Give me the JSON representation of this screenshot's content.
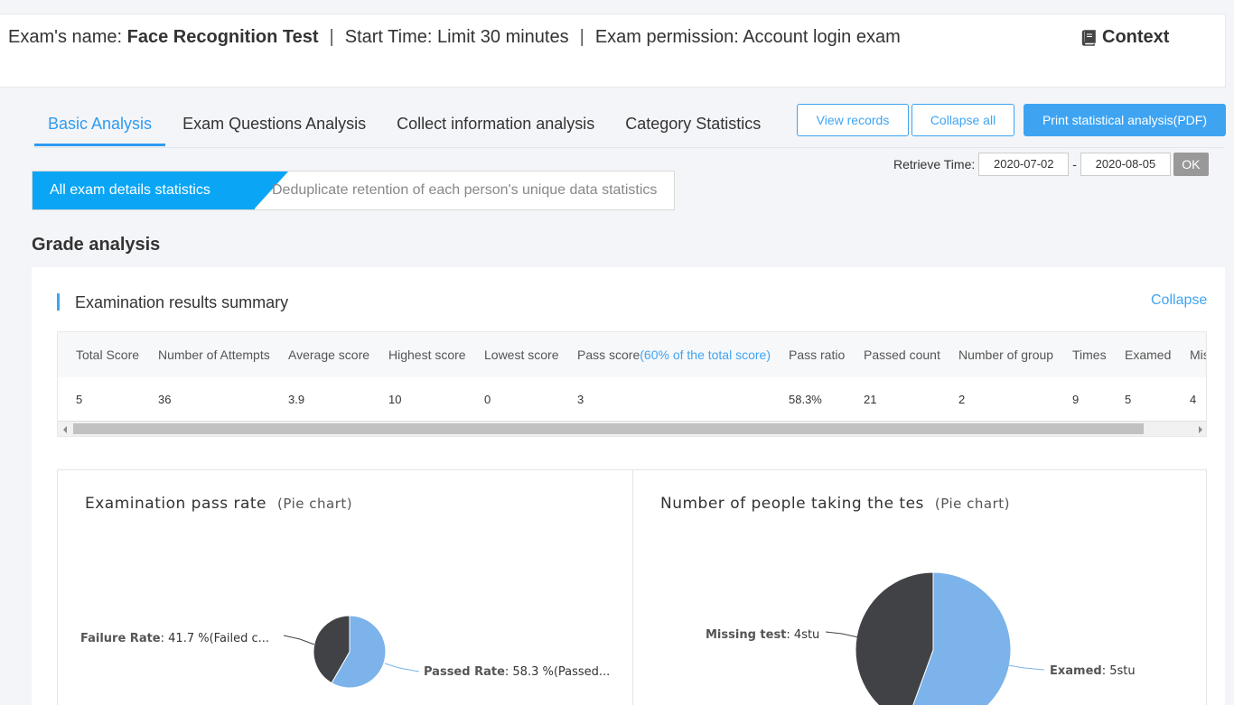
{
  "header": {
    "name_label": "Exam's name: ",
    "name_value": "Face Recognition Test",
    "start_time": "Start Time: Limit 30 minutes",
    "permission": "Exam permission: Account login exam",
    "separator": "|",
    "context_label": "Context"
  },
  "tabs": [
    {
      "label": "Basic Analysis"
    },
    {
      "label": "Exam Questions Analysis"
    },
    {
      "label": "Collect information analysis"
    },
    {
      "label": "Category Statistics"
    }
  ],
  "toolbar": {
    "view_records": "View records",
    "collapse_all": "Collapse all",
    "print_pdf": "Print statistical analysis(PDF)"
  },
  "retrieve": {
    "label": "Retrieve Time:",
    "start": "2020-07-02",
    "dash": "-",
    "end": "2020-08-05",
    "ok": "OK"
  },
  "toggle": {
    "active": "All exam details statistics",
    "inactive": "Deduplicate retention of each person's unique data statistics"
  },
  "grade_section": {
    "title": "Grade analysis",
    "summary_title": "Examination results summary",
    "collapse": "Collapse"
  },
  "summary_table": {
    "headers": [
      "Total Score",
      "Number of Attempts",
      "Average score",
      "Highest score",
      "Lowest score",
      "Pass score",
      "Pass ratio",
      "Passed count",
      "Number of group",
      "Times",
      "Examed",
      "Mis"
    ],
    "pass_score_note": "(60% of the total score)",
    "row": [
      "5",
      "36",
      "3.9",
      "10",
      "0",
      "3",
      "58.3%",
      "21",
      "2",
      "9",
      "5",
      "4"
    ]
  },
  "pass_rate_chart": {
    "title": "Examination pass rate",
    "subtitle": "(Pie chart)",
    "failure_name": "Failure Rate",
    "failure_text": ": 41.7 %(Failed c...",
    "passed_name": "Passed Rate",
    "passed_text": ": 58.3 %(Passed..."
  },
  "people_chart": {
    "title": "Number of people taking the tes",
    "subtitle": "(Pie chart)",
    "missing_name": "Missing test",
    "missing_text": ": 4stu",
    "examed_name": "Examed",
    "examed_text": ": 5stu"
  },
  "chart_data": [
    {
      "type": "pie",
      "categories": [
        "Failure Rate",
        "Passed Rate"
      ],
      "values": [
        41.7,
        58.3
      ],
      "colors": [
        "#414246",
        "#7bb3ea"
      ]
    },
    {
      "type": "pie",
      "categories": [
        "Missing test",
        "Examed"
      ],
      "values": [
        4,
        5
      ],
      "colors": [
        "#414246",
        "#7bb3ea"
      ]
    }
  ]
}
